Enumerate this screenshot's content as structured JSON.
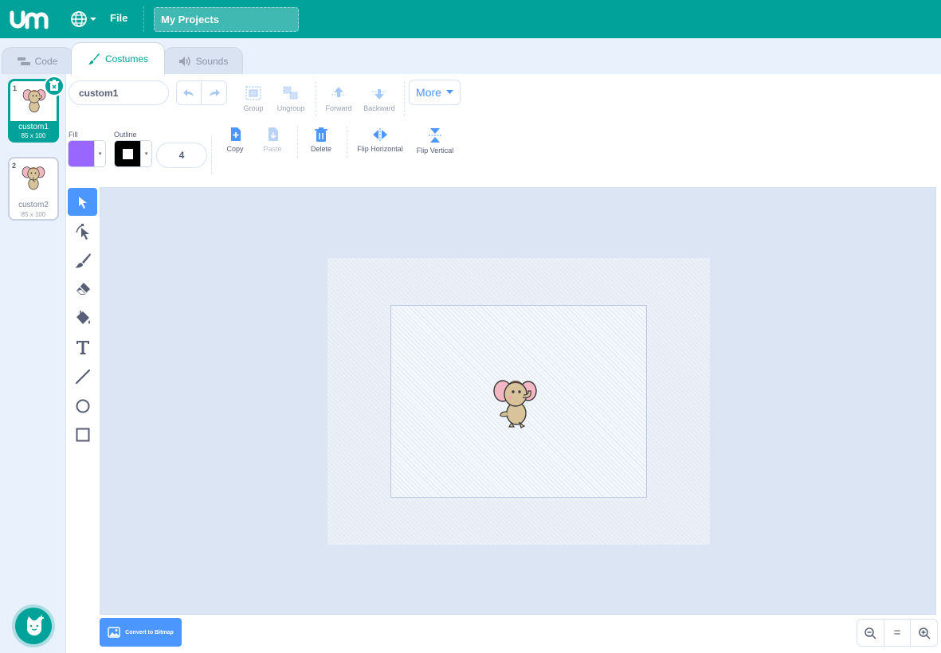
{
  "header": {
    "file_label": "File",
    "project_title": "My Projects"
  },
  "tabs": [
    {
      "label": "Code",
      "icon": "code-blocks-icon"
    },
    {
      "label": "Costumes",
      "icon": "brush-icon",
      "active": true
    },
    {
      "label": "Sounds",
      "icon": "speaker-icon"
    }
  ],
  "costumes": [
    {
      "number": "1",
      "name": "custom1",
      "size": "85 x 100",
      "selected": true
    },
    {
      "number": "2",
      "name": "custom2",
      "size": "85 x 100",
      "selected": false
    }
  ],
  "toolbar": {
    "costume_name": "custom1",
    "group_label": "Group",
    "ungroup_label": "Ungroup",
    "forward_label": "Forward",
    "backward_label": "Backward",
    "more_label": "More",
    "fill_label": "Fill",
    "outline_label": "Outline",
    "outline_width": "4",
    "copy_label": "Copy",
    "paste_label": "Paste",
    "delete_label": "Delete",
    "flip_h_label": "Flip Horizontal",
    "flip_v_label": "Flip Vertical"
  },
  "colors": {
    "brand": "#00a29a",
    "accent": "#4c97ff",
    "fill": "#9966ff",
    "outline": "#000000"
  },
  "tools": [
    "select",
    "reshape",
    "brush",
    "eraser",
    "fill",
    "text",
    "line",
    "circle",
    "rectangle"
  ],
  "canvas": {
    "convert_label": "Convert to Bitmap",
    "zoom_reset_label": "="
  }
}
